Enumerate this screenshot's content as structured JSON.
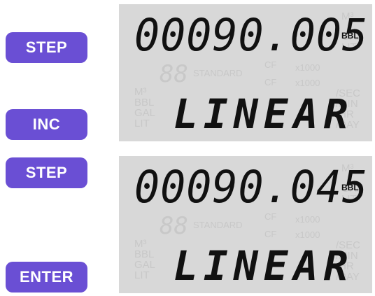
{
  "buttons": [
    {
      "label": "STEP"
    },
    {
      "label": "INC"
    },
    {
      "label": "STEP"
    },
    {
      "label": "ENTER"
    }
  ],
  "displays": [
    {
      "reading": "00090.005",
      "unit": "BBL",
      "mode": "LINEAR"
    },
    {
      "reading": "00090.045",
      "unit": "BBL",
      "mode": "LINEAR"
    }
  ],
  "legend": {
    "flow_units": [
      "M³",
      "GAL",
      "LIT"
    ],
    "standard": "STANDARD",
    "cf": "CF",
    "x1000": "x1000",
    "digits": "88",
    "left_units": [
      "M³",
      "BBL",
      "GAL",
      "LIT"
    ],
    "rate_units": [
      "/SEC",
      "/MIN",
      "/HR",
      "/DAY"
    ]
  },
  "colors": {
    "button_bg": "#6a4fd4",
    "lcd_bg": "#d8d8d8",
    "segment_on": "#111111",
    "segment_off": "#c8c8c8"
  }
}
